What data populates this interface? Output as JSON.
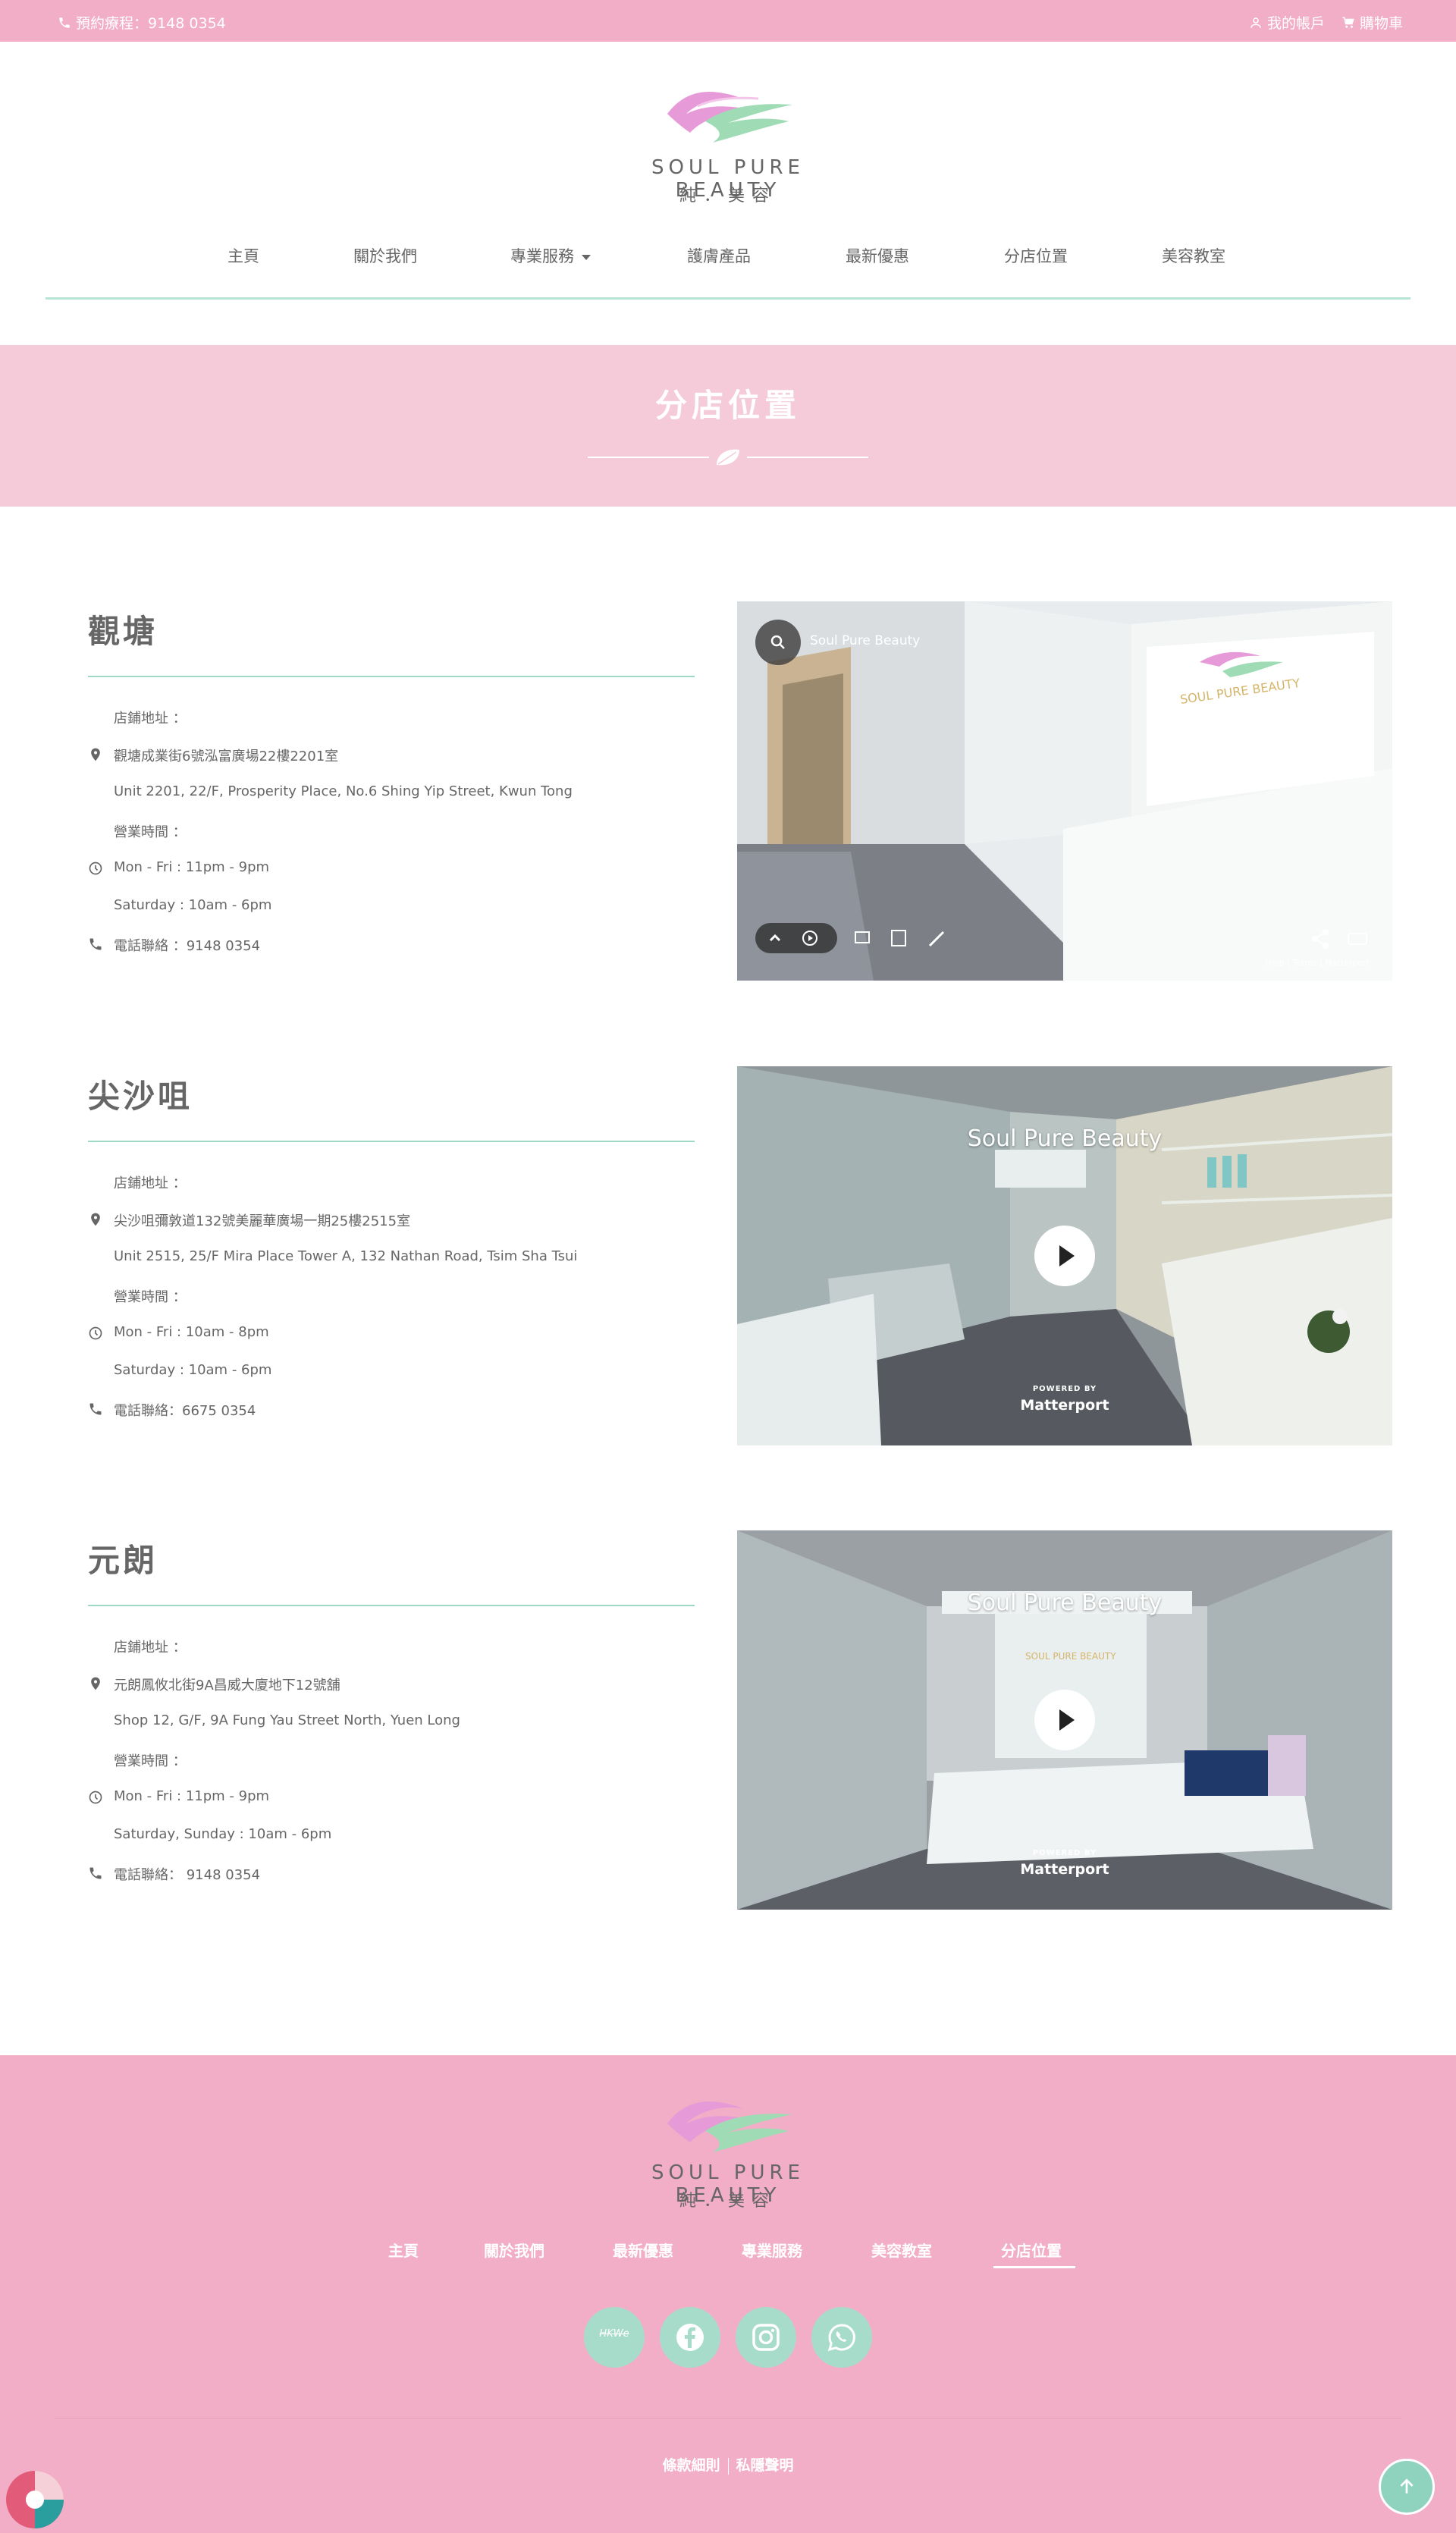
{
  "topbar": {
    "booking": "預約療程：9148 0354",
    "account": "我的帳戶",
    "cart": "購物車"
  },
  "logo": {
    "brand": "SOUL PURE BEAUTY",
    "sub": "純．美容"
  },
  "nav": {
    "items": [
      "主頁",
      "關於我們",
      "專業服務",
      "護膚產品",
      "最新優惠",
      "分店位置",
      "美容教室"
    ]
  },
  "banner": {
    "title": "分店位置"
  },
  "branches": [
    {
      "name": "觀塘",
      "address_label": "店鋪地址 ：",
      "address_zh": "觀塘成業街6號泓富廣場22樓2201室",
      "address_en": "Unit 2201, 22/F, Prosperity Place, No.6 Shing Yip Street, Kwun Tong",
      "hours_label": "營業時間 ：",
      "hours_1": "Mon - Fri : 11pm - 9pm",
      "hours_2": "Saturday : 10am - 6pm",
      "phone": "電話聯絡 ：9148 0354",
      "tour_name": "Soul Pure Beauty",
      "tour_legal": "Help  |  Terms  |  Matterport"
    },
    {
      "name": "尖沙咀",
      "address_label": "店鋪地址 ：",
      "address_zh": "尖沙咀彌敦道132號美麗華廣場一期25樓2515室",
      "address_en": "Unit 2515, 25/F Mira Place Tower A, 132 Nathan Road, Tsim Sha Tsui",
      "hours_label": "營業時間 ：",
      "hours_1": "Mon - Fri : 10am - 8pm",
      "hours_2": "Saturday : 10am - 6pm",
      "phone": "電話聯絡：6675 0354",
      "tour_name": "Soul Pure Beauty",
      "powered": "POWERED BY",
      "mport": "Matterport"
    },
    {
      "name": "元朗",
      "address_label": "店鋪地址 ：",
      "address_zh": "元朗鳳攸北街9A昌威大廈地下12號舖",
      "address_en": "Shop 12, G/F, 9A Fung Yau Street North, Yuen Long",
      "hours_label": "營業時間 ：",
      "hours_1": "Mon - Fri : 11pm - 9pm",
      "hours_2": "Saturday, Sunday : 10am - 6pm",
      "phone": "電話聯絡： 9148 0354",
      "tour_name": "Soul Pure Beauty",
      "powered": "POWERED BY",
      "mport": "Matterport"
    }
  ],
  "footer": {
    "brand": "SOUL PURE BEAUTY",
    "sub": "純．美容",
    "nav": [
      "主頁",
      "關於我們",
      "最新優惠",
      "專業服務",
      "美容教室",
      "分店位置"
    ],
    "social_hkt": "HKWe",
    "terms": "條款細則",
    "privacy": "私隱聲明"
  },
  "colors": {
    "pink": "#f2aec6",
    "banner_pink": "#f5cbd9",
    "mint": "#a7dccb",
    "text": "#666666"
  },
  "icons": [
    "phone-icon",
    "user-icon",
    "cart-icon",
    "map-pin-icon",
    "clock-icon",
    "facebook-icon",
    "instagram-icon",
    "whatsapp-icon",
    "arrow-up-icon",
    "search-icon",
    "play-icon",
    "share-icon"
  ]
}
